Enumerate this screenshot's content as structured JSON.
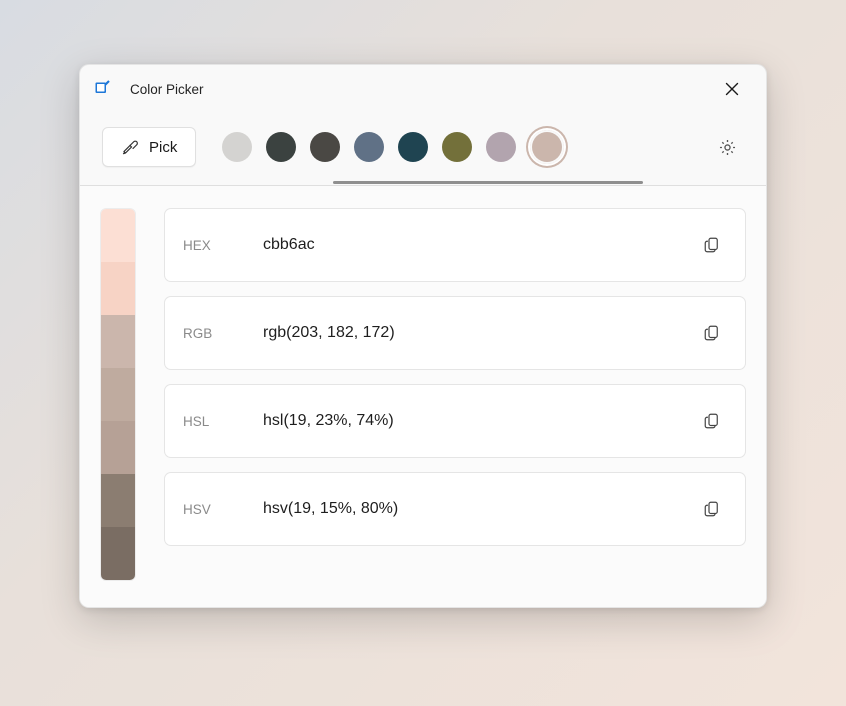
{
  "window": {
    "title": "Color Picker"
  },
  "toolbar": {
    "pick_label": "Pick",
    "swatches": [
      {
        "color": "#d4d3d1",
        "selected": false
      },
      {
        "color": "#3b4240",
        "selected": false
      },
      {
        "color": "#4a4844",
        "selected": false
      },
      {
        "color": "#607186",
        "selected": false
      },
      {
        "color": "#1f4451",
        "selected": false
      },
      {
        "color": "#73703a",
        "selected": false
      },
      {
        "color": "#b2a4ae",
        "selected": false
      },
      {
        "color": "#cbb6ac",
        "selected": true
      }
    ]
  },
  "shades": [
    "#fcdfd4",
    "#f7d3c5",
    "#cbb6ac",
    "#bfab9f",
    "#b6a196",
    "#8b7d71",
    "#7a6d63"
  ],
  "formats": [
    {
      "label": "HEX",
      "value": "cbb6ac"
    },
    {
      "label": "RGB",
      "value": "rgb(203, 182, 172)"
    },
    {
      "label": "HSL",
      "value": "hsl(19, 23%, 74%)"
    },
    {
      "label": "HSV",
      "value": "hsv(19, 15%, 80%)"
    }
  ]
}
